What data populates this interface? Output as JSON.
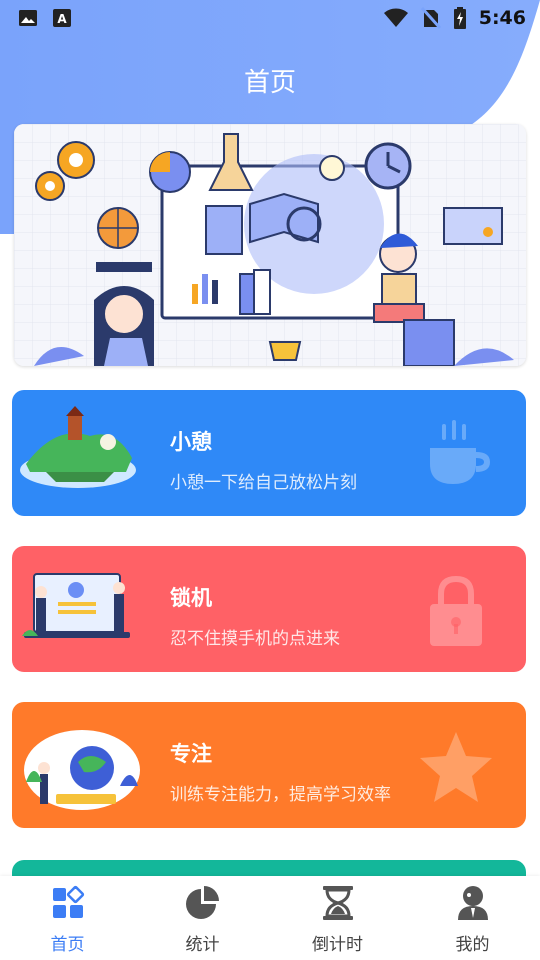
{
  "status_bar": {
    "time": "5:46",
    "icons": [
      "image-icon",
      "text-icon",
      "wifi-icon",
      "no-sim-icon",
      "battery-charging-icon"
    ]
  },
  "header": {
    "title": "首页"
  },
  "banner": {
    "illustration": "study-illustration"
  },
  "cards": [
    {
      "title": "小憩",
      "subtitle": "小憩一下给自己放松片刻",
      "icon": "coffee-cup-icon",
      "color": "#2f89f7"
    },
    {
      "title": "锁机",
      "subtitle": "忍不住摸手机的点进来",
      "icon": "padlock-icon",
      "color": "#ff6166"
    },
    {
      "title": "专注",
      "subtitle": "训练专注能力，提高学习效率",
      "icon": "star-icon",
      "color": "#ff7a2a"
    }
  ],
  "tabbar": {
    "active": "首页",
    "items": [
      {
        "label": "首页",
        "icon": "grid-icon"
      },
      {
        "label": "统计",
        "icon": "pie-chart-icon"
      },
      {
        "label": "倒计时",
        "icon": "hourglass-icon"
      },
      {
        "label": "我的",
        "icon": "person-icon"
      }
    ]
  },
  "colors": {
    "accent": "#3c7df5",
    "header_blue": "#7ea6fb",
    "rest": "#2f89f7",
    "lock": "#ff6166",
    "focus": "#ff7a2a",
    "next": "#13b79a"
  }
}
